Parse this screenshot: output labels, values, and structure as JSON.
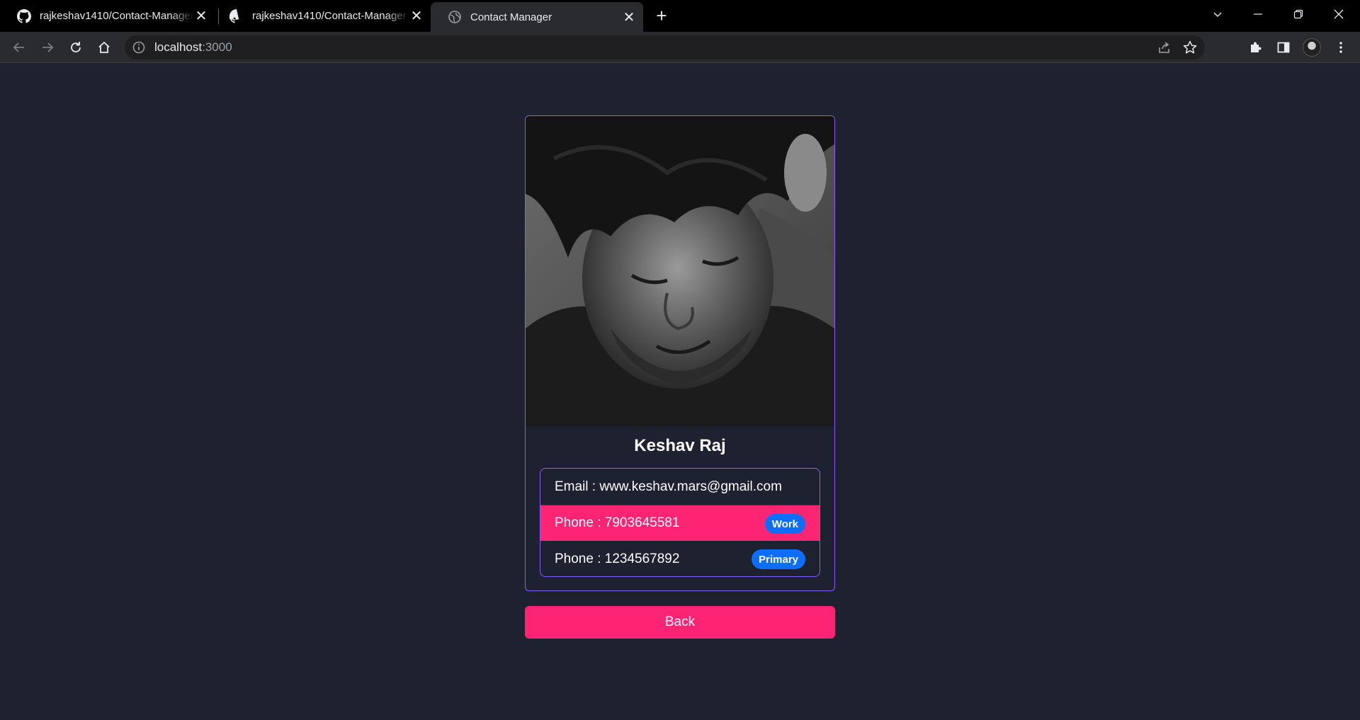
{
  "browser": {
    "tabs": [
      {
        "title": "rajkeshav1410/Contact-Manager",
        "icon": "github-icon",
        "active": false
      },
      {
        "title": "rajkeshav1410/Contact-Manager",
        "icon": "github-icon",
        "active": false
      },
      {
        "title": "Contact Manager",
        "icon": "globe-icon",
        "active": true
      }
    ],
    "address": {
      "host": "localhost",
      "port": ":3000"
    },
    "colors": {
      "frame": "#000000",
      "toolbar": "#2a2b2f"
    }
  },
  "page": {
    "background": "#1e2130",
    "contact": {
      "name": "Keshav Raj",
      "email_line": "Email : www.keshav.mars@gmail.com",
      "phones": [
        {
          "text": "Phone : 7903645581",
          "badge": "Work",
          "highlighted": true
        },
        {
          "text": "Phone : 1234567892",
          "badge": "Primary",
          "highlighted": false
        }
      ]
    },
    "back_label": "Back",
    "colors": {
      "accent": "#fe2474",
      "border": "#8b5cf6",
      "badge": "#0d6efd"
    }
  }
}
